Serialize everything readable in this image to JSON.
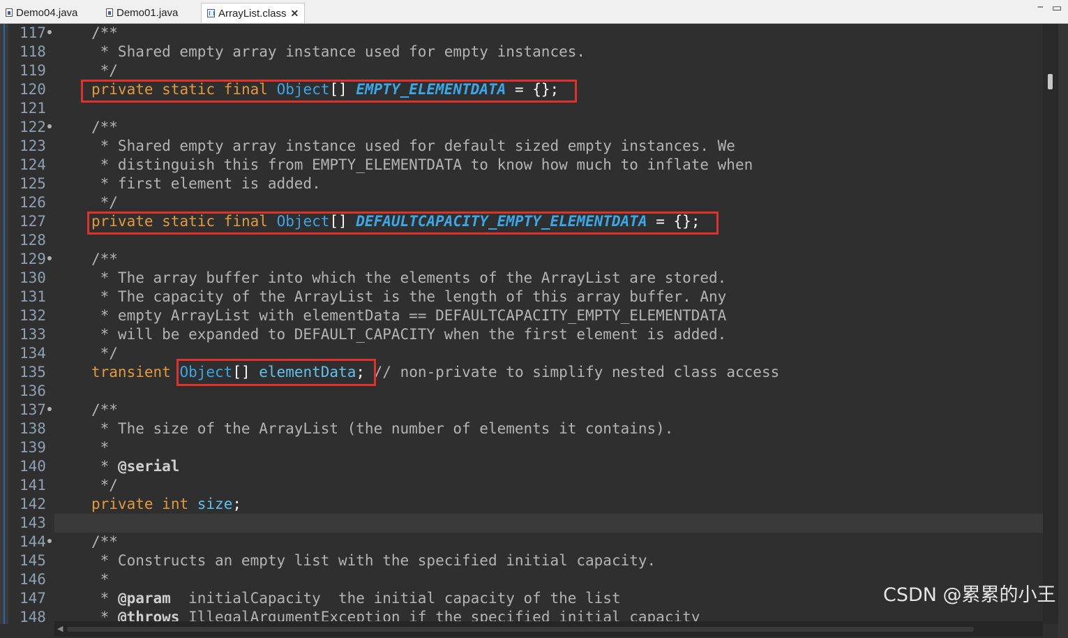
{
  "tabs": [
    {
      "label": "Demo04.java",
      "active": false
    },
    {
      "label": "Demo01.java",
      "active": false
    },
    {
      "label": "ArrayList.class",
      "active": true
    }
  ],
  "window_controls": {
    "minimize": "−",
    "maximize": "▭"
  },
  "line_numbers": [
    "117",
    "118",
    "119",
    "120",
    "121",
    "122",
    "123",
    "124",
    "125",
    "126",
    "127",
    "128",
    "129",
    "130",
    "131",
    "132",
    "133",
    "134",
    "135",
    "136",
    "137",
    "138",
    "139",
    "140",
    "141",
    "142",
    "143",
    "144",
    "145",
    "146",
    "147",
    "148"
  ],
  "folded_lines": [
    "117",
    "122",
    "129",
    "137",
    "144"
  ],
  "code": {
    "l117": "/**",
    "l118": " * Shared empty array instance used for empty instances.",
    "l119": " */",
    "l120": {
      "k1": "private",
      "k2": "static",
      "k3": "final",
      "type": "Object",
      "br": "[]",
      "name": "EMPTY_ELEMENTDATA",
      "tail": " = {};"
    },
    "l122": "/**",
    "l123": " * Shared empty array instance used for default sized empty instances. We",
    "l124": " * distinguish this from EMPTY_ELEMENTDATA to know how much to inflate when",
    "l125": " * first element is added.",
    "l126": " */",
    "l127": {
      "k1": "private",
      "k2": "static",
      "k3": "final",
      "type": "Object",
      "br": "[]",
      "name": "DEFAULTCAPACITY_EMPTY_ELEMENTDATA",
      "tail": " = {};"
    },
    "l129": "/**",
    "l130": " * The array buffer into which the elements of the ArrayList are stored.",
    "l131": " * The capacity of the ArrayList is the length of this array buffer. Any",
    "l132": " * empty ArrayList with elementData == DEFAULTCAPACITY_EMPTY_ELEMENTDATA",
    "l133": " * will be expanded to DEFAULT_CAPACITY when the first element is added.",
    "l134": " */",
    "l135": {
      "k1": "transient",
      "type": "Object",
      "br": "[]",
      "name": "elementData",
      "semi": ";",
      "comment": "// non-private to simplify nested class access"
    },
    "l137": "/**",
    "l138": " * The size of the ArrayList (the number of elements it contains).",
    "l139": " *",
    "l140": {
      "pre": " * ",
      "tag": "@serial"
    },
    "l141": " */",
    "l142": {
      "k1": "private",
      "k2": "int",
      "name": "size",
      "semi": ";"
    },
    "l144": "/**",
    "l145": " * Constructs an empty list with the specified initial capacity.",
    "l146": " *",
    "l147": {
      "pre": " * ",
      "tag": "@param",
      "rest": "  initialCapacity  the initial capacity of the list"
    },
    "l148": {
      "pre": " * ",
      "tag": "@throws",
      "rest": " IllegalArgumentException if the specified initial capacity"
    }
  },
  "watermark": "CSDN @累累的小王"
}
